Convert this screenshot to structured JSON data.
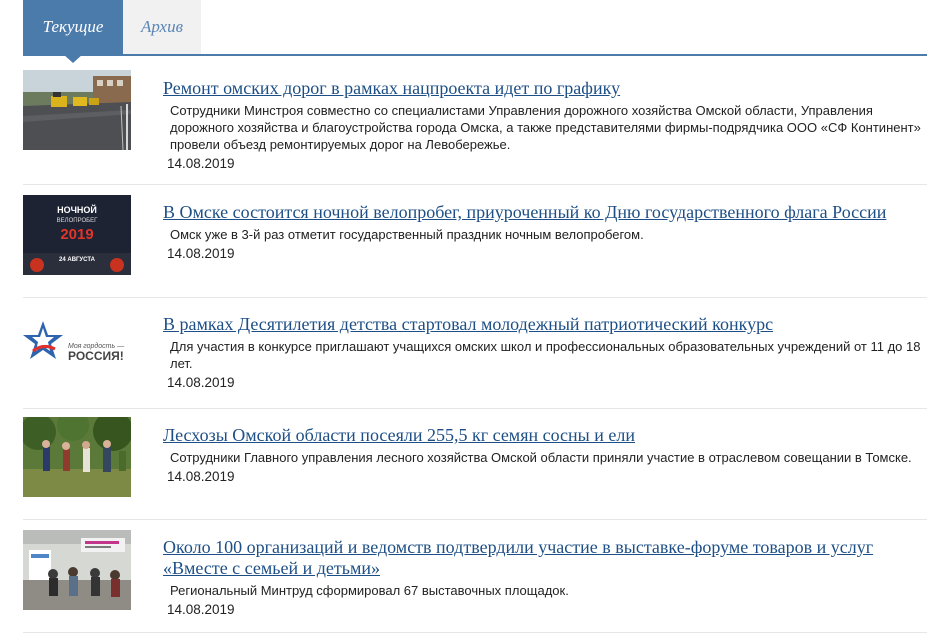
{
  "tabs": [
    {
      "label": "Текущие",
      "active": true
    },
    {
      "label": "Архив",
      "active": false
    }
  ],
  "colors": {
    "tab_active_bg": "#4b7bab",
    "tab_inactive_text": "#5a86b5",
    "link": "#1d4f86"
  },
  "news": [
    {
      "title": "Ремонт омских дорог в рамках нацпроекта идет по графику",
      "description": "Сотрудники Минстроя совместно со специалистами Управления дорожного хозяйства Омской области, Управления дорожного хозяйства и благоустройства города Омска, а также представителями фирмы-подрядчика ООО «СФ Континент» провели объезд ремонтируемых дорог на Левобережье.",
      "date": "14.08.2019",
      "image": "road-paving-photo"
    },
    {
      "title": "В Омске состоится ночной велопробег, приуроченный ко Дню государственного флага России",
      "description": "Омск уже в 3-й раз отметит государственный праздник ночным велопробегом.",
      "date": "14.08.2019",
      "image": "night-bike-ride-poster",
      "poster_text": {
        "line1": "НОЧНОЙ",
        "line2": "ВЕЛОПРОБЕГ",
        "year": "2019",
        "when": "24 АВГУСТА"
      }
    },
    {
      "title": "В рамках Десятилетия детства стартовал молодежный патриотический конкурс",
      "description": "Для участия в конкурсе приглашают учащихся омских школ и профессиональных образовательных учреждений от 11 до 18 лет.",
      "date": "14.08.2019",
      "image": "contest-logo",
      "logo_text": {
        "line1": "Моя гордость —",
        "line2": "РОССИЯ!"
      }
    },
    {
      "title": "Лесхозы Омской области посеяли 255,5 кг семян сосны и ели",
      "description": "Сотрудники Главного управления лесного хозяйства Омской области приняли участие в отраслевом совещании в Томске.",
      "date": "14.08.2019",
      "image": "forest-meeting-photo"
    },
    {
      "title": "Около 100 организаций и ведомств подтвердили участие в выставке-форуме товаров и услуг «Вместе с семьей и детьми»",
      "description": "Региональный Минтруд сформировал 67 выставочных площадок.",
      "date": "14.08.2019",
      "image": "exhibition-hall-photo"
    }
  ]
}
